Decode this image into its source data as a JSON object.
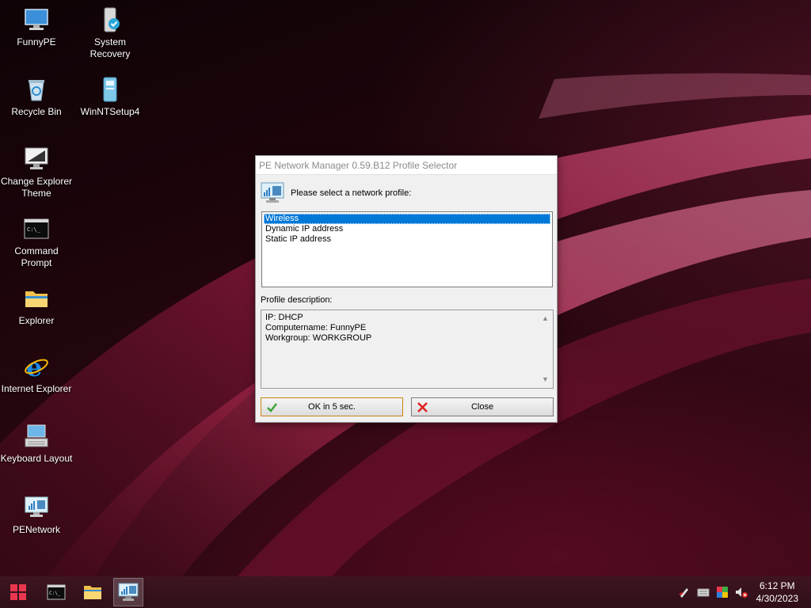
{
  "desktop": {
    "icons": [
      {
        "label": "FunnyPE",
        "icon": "computer-icon"
      },
      {
        "label": "System Recovery",
        "icon": "system-recovery-icon"
      },
      {
        "label": "Recycle Bin",
        "icon": "recycle-bin-icon"
      },
      {
        "label": "WinNTSetup4",
        "icon": "winntsetup-icon"
      },
      {
        "label": "Change Explorer Theme",
        "icon": "theme-icon"
      },
      {
        "label": "Command Prompt",
        "icon": "command-prompt-icon"
      },
      {
        "label": "Explorer",
        "icon": "folder-icon"
      },
      {
        "label": "Internet Explorer",
        "icon": "internet-explorer-icon"
      },
      {
        "label": "Keyboard Layout",
        "icon": "keyboard-icon"
      },
      {
        "label": "PENetwork",
        "icon": "network-icon"
      }
    ]
  },
  "dialog": {
    "title": "PE Network Manager 0.59.B12 Profile Selector",
    "prompt": "Please select a network profile:",
    "profiles": [
      "Wireless",
      "Dynamic IP address",
      "Static IP address"
    ],
    "selected_profile": "Wireless",
    "description_label": "Profile description:",
    "description_lines": [
      "IP: DHCP",
      "Computername: FunnyPE",
      "Workgroup: WORKGROUP"
    ],
    "ok_label": "OK in 5 sec.",
    "close_label": "Close"
  },
  "taskbar": {
    "apps": [
      "start-icon",
      "command-prompt-icon",
      "folder-icon",
      "network-icon"
    ],
    "tray": [
      "pen-icon",
      "keyboard-icon",
      "color-icon",
      "volume-muted-icon"
    ],
    "time": "6:12 PM",
    "date": "4/30/2023"
  },
  "colors": {
    "selection": "#0078d7",
    "accent_ok_border": "#c8860e",
    "start_red": "#e8374f"
  }
}
